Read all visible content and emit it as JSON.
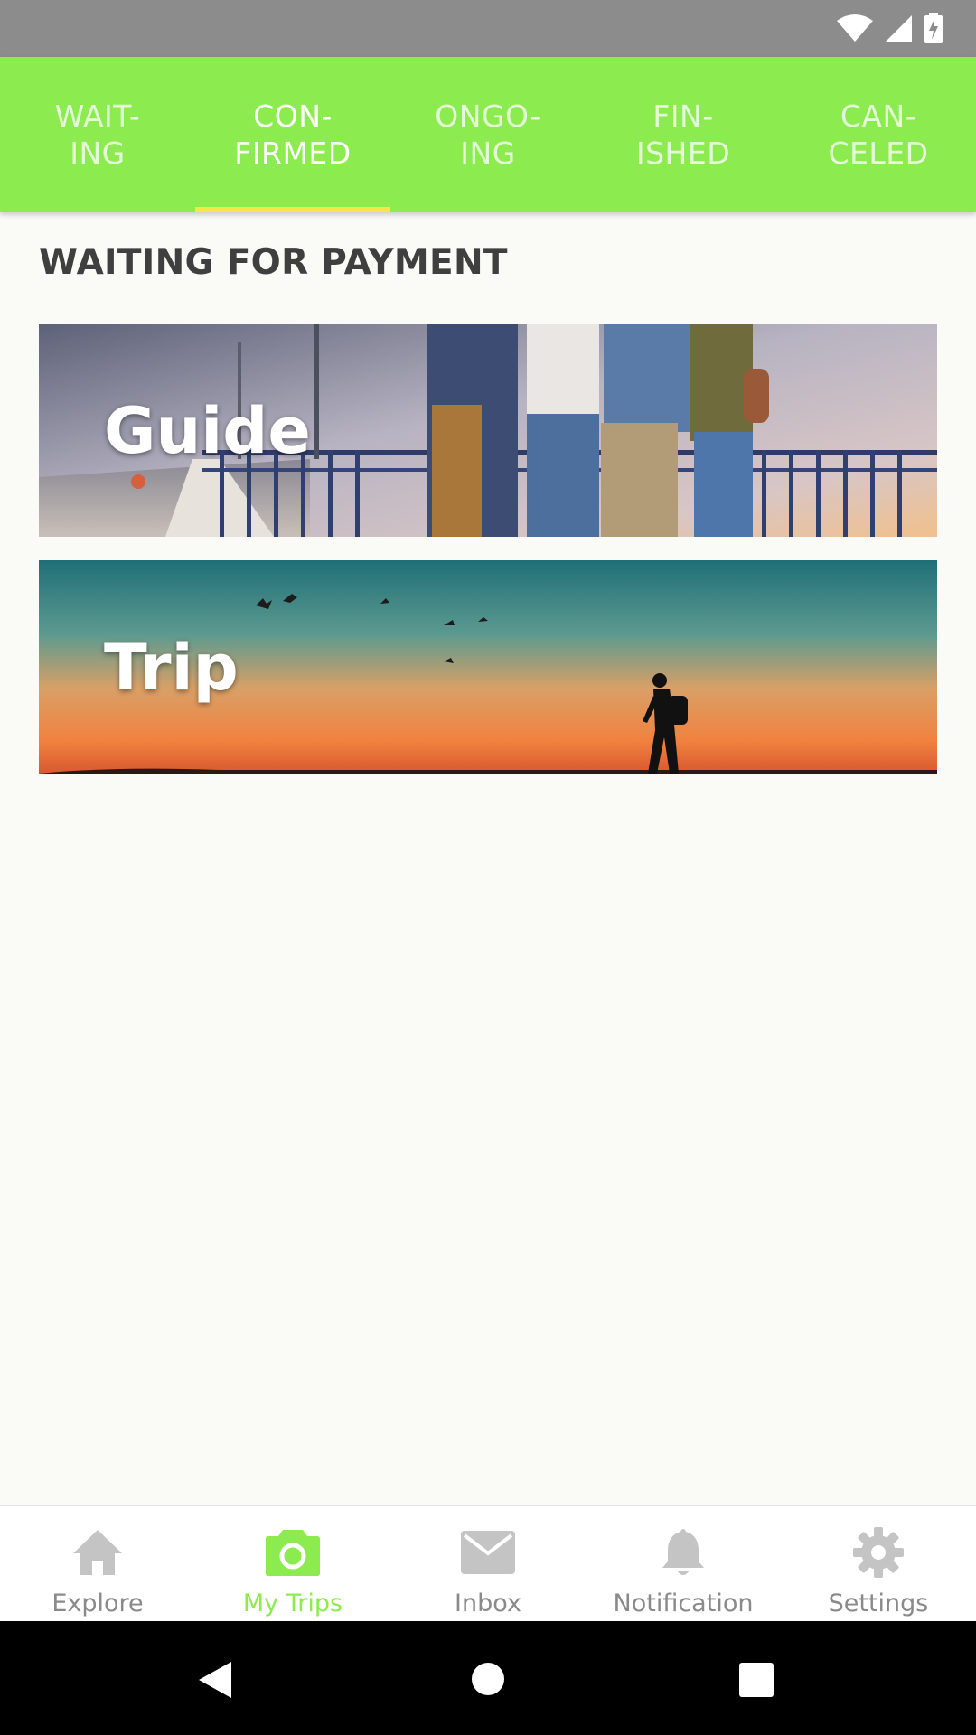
{
  "colors": {
    "accent": "#8beb4f",
    "tab_indicator": "#f6e64a",
    "inactive_icon": "#c4c4c4"
  },
  "status_bar": {
    "icons": [
      "wifi-icon",
      "cell-signal-icon",
      "battery-charging-icon"
    ]
  },
  "tabs": [
    {
      "label": "WAIT-\nING",
      "active": false
    },
    {
      "label": "CON-\nFIRMED",
      "active": true
    },
    {
      "label": "ONGO-\nING",
      "active": false
    },
    {
      "label": "FIN-\nISHED",
      "active": false
    },
    {
      "label": "CAN-\nCELED",
      "active": false
    }
  ],
  "main": {
    "section_title": "WAITING FOR PAYMENT",
    "cards": [
      {
        "label": "Guide"
      },
      {
        "label": "Trip"
      }
    ]
  },
  "bottom_nav": {
    "items": [
      {
        "label": "Explore",
        "icon": "home-icon",
        "active": false
      },
      {
        "label": "My Trips",
        "icon": "camera-icon",
        "active": true
      },
      {
        "label": "Inbox",
        "icon": "mail-icon",
        "active": false
      },
      {
        "label": "Notification",
        "icon": "bell-icon",
        "active": false
      },
      {
        "label": "Settings",
        "icon": "gear-icon",
        "active": false
      }
    ]
  },
  "system_nav": {
    "icons": [
      "back-icon",
      "home-circle-icon",
      "recents-icon"
    ]
  }
}
